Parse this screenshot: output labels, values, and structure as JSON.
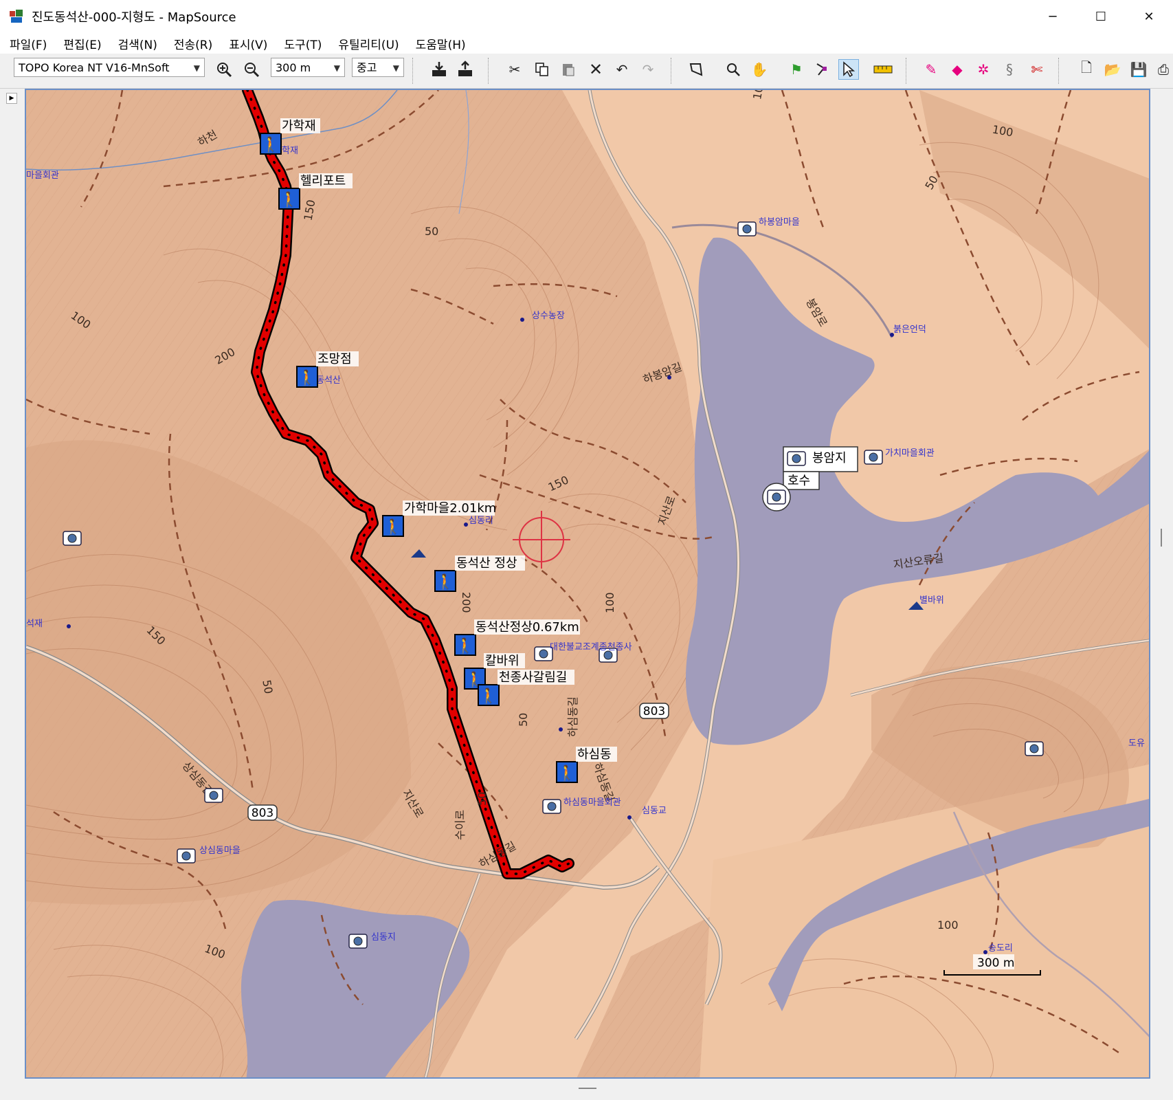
{
  "window": {
    "title": "진도동석산-000-지형도 - MapSource",
    "minimize": "─",
    "maximize": "☐",
    "close": "✕"
  },
  "menu": [
    "파일(F)",
    "편집(E)",
    "검색(N)",
    "전송(R)",
    "표시(V)",
    "도구(T)",
    "유틸리티(U)",
    "도움말(H)"
  ],
  "toolbar": {
    "map_product": "TOPO Korea NT V16-MnSoft",
    "zoom_scale": "300 m",
    "detail_level": "중고"
  },
  "map": {
    "waypoints": {
      "w1": "가학재",
      "w2": "헬리포트",
      "w3": "조망점",
      "w4": "가학마을2.01km",
      "w5": "동석산 정상",
      "w6": "동석산정상0.67km",
      "w7": "칼바위",
      "w8": "천종사갈림길",
      "w9": "하심동"
    },
    "tooltip": {
      "name": "봉암지",
      "type": "호수"
    },
    "places": {
      "p1": "마을회관",
      "p2": "하봉암마을",
      "p3": "상수농장",
      "p4": "붉은언덕",
      "p5": "가치마을회관",
      "p6": "대한불교조계종천종사",
      "p7": "하심동마을회관",
      "p8": "심동교",
      "p9": "상심동마을",
      "p10": "심동지",
      "p11": "별바위",
      "p12": "송도리",
      "p13": "심동리",
      "p14": "학재",
      "p15": "석재",
      "p16": "동석산",
      "p17": "도유"
    },
    "roads": {
      "r1": "하천",
      "r2": "하봉암길",
      "r3": "지산로",
      "r4": "지산오류길",
      "r5": "하심동길",
      "r6": "하심동길",
      "r7": "상심동길",
      "r8": "지산로",
      "r9": "수이로",
      "r10": "봉암로",
      "r11": "하심동길"
    },
    "route_numbers": {
      "n1": "803",
      "n2": "803"
    },
    "contours": {
      "c1": "150",
      "c2": "50",
      "c3": "100",
      "c4": "200",
      "c5": "150",
      "c6": "50",
      "c7": "150",
      "c8": "200",
      "c9": "100",
      "c10": "50",
      "c11": "50",
      "c12": "100",
      "c13": "100",
      "c14": "50",
      "c15": "100",
      "c16": "100"
    },
    "scale_label": "300 m"
  }
}
